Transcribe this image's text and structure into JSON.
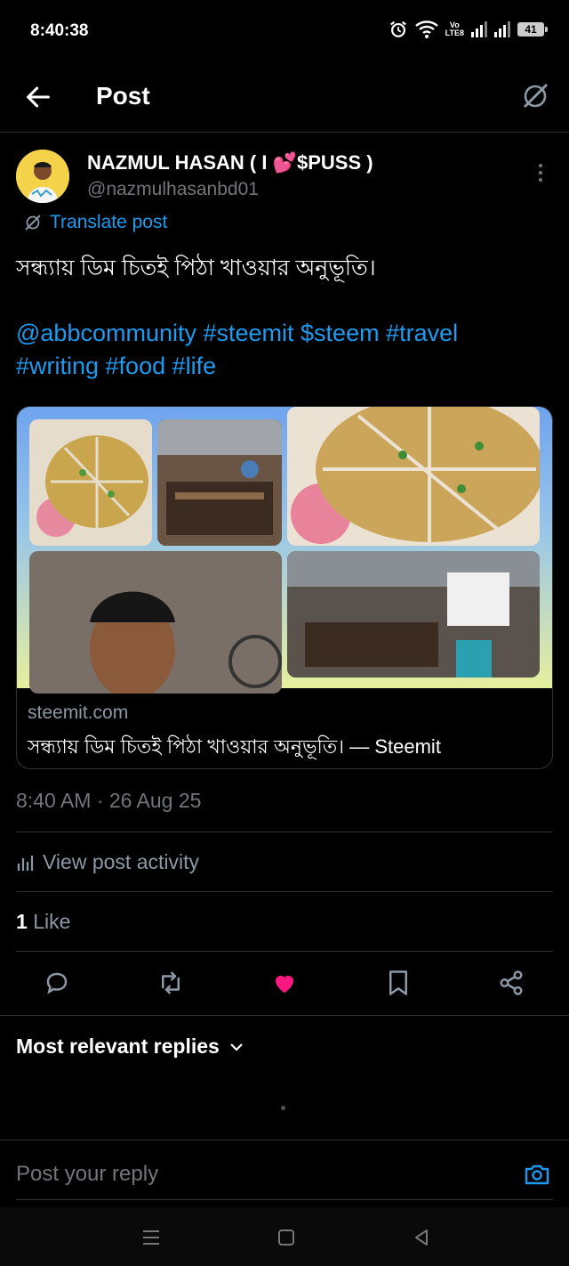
{
  "status_bar": {
    "time": "8:40:38",
    "network_label_top": "Vo",
    "network_label_bottom": "LTE8",
    "battery": "41",
    "icons": [
      "alarm-icon",
      "wifi-icon",
      "signal-icon",
      "signal-icon",
      "battery-icon"
    ]
  },
  "header": {
    "title": "Post",
    "back_icon": "arrow-left-icon",
    "grok_icon": "grok-icon"
  },
  "post": {
    "author_name": "NAZMUL HASAN ( I 💕$PUSS )",
    "author_handle": "@nazmulhasanbd01",
    "translate_label": "Translate post",
    "text": "সন্ধ্যায় ডিম চিতই পিঠা খাওয়ার অনুভূতি।",
    "tags_line1": "@abbcommunity #steemit $steem #travel",
    "tags_line2": "#writing #food #life",
    "timestamp": "8:40 AM · 26 Aug 25",
    "activity_label": "View post activity",
    "like_count": "1",
    "like_label": "Like"
  },
  "link_card": {
    "domain": "steemit.com",
    "title": "সন্ধ্যায় ডিম চিতই পিঠা খাওয়ার অনুভূতি। — Steemit"
  },
  "actions": [
    "reply-icon",
    "repost-icon",
    "like-icon",
    "bookmark-icon",
    "share-icon"
  ],
  "replies": {
    "sort_label": "Most relevant replies",
    "reply_placeholder": "Post your reply"
  },
  "colors": {
    "accent": "#1d9bf0",
    "like": "#f91880",
    "background": "#000000",
    "muted": "#71767b"
  }
}
